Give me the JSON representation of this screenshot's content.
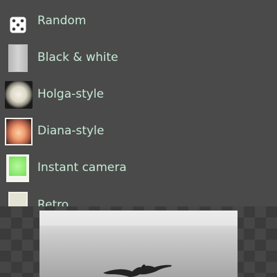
{
  "menu": {
    "items": [
      {
        "label": "Random",
        "icon": "dice-icon"
      },
      {
        "label": "Black & white",
        "icon": "bw-thumbnail"
      },
      {
        "label": "Holga-style",
        "icon": "holga-thumbnail"
      },
      {
        "label": "Diana-style",
        "icon": "diana-thumbnail"
      },
      {
        "label": "Instant camera",
        "icon": "instant-thumbnail"
      },
      {
        "label": "Retro",
        "icon": "retro-thumbnail"
      }
    ]
  },
  "colors": {
    "background": "#4a4a4a",
    "label_text": "#c9ead7"
  }
}
